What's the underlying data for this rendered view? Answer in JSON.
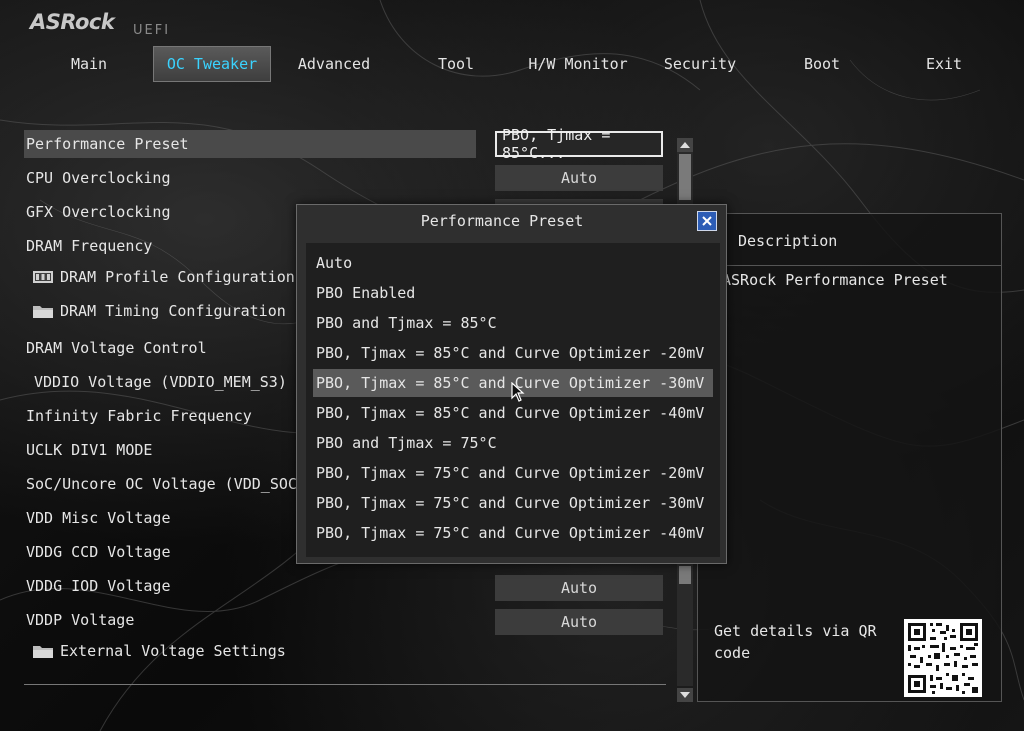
{
  "brand": {
    "logo": "ASRock",
    "sub": "UEFI"
  },
  "tabs": [
    {
      "label": "Main"
    },
    {
      "label": "OC Tweaker",
      "active": true
    },
    {
      "label": "Advanced"
    },
    {
      "label": "Tool"
    },
    {
      "label": "H/W Monitor"
    },
    {
      "label": "Security"
    },
    {
      "label": "Boot"
    },
    {
      "label": "Exit"
    }
  ],
  "settings": [
    {
      "label": "Performance Preset",
      "value": "PBO, Tjmax = 85°C..."
    },
    {
      "label": "CPU Overclocking",
      "value": "Auto"
    },
    {
      "label": "GFX Overclocking"
    },
    {
      "label": "DRAM Frequency"
    },
    {
      "label": "DRAM Profile Configuration",
      "icon": "memory-module-icon"
    },
    {
      "label": "DRAM Timing Configuration",
      "icon": "folder-icon"
    },
    {
      "label": "DRAM Voltage Control"
    },
    {
      "label": "VDDIO Voltage (VDDIO_MEM_S3)"
    },
    {
      "label": "Infinity Fabric Frequency"
    },
    {
      "label": "UCLK DIV1 MODE"
    },
    {
      "label": "SoC/Uncore OC Voltage (VDD_SOC)"
    },
    {
      "label": "VDD Misc Voltage"
    },
    {
      "label": "VDDG CCD Voltage"
    },
    {
      "label": "VDDG IOD Voltage",
      "value": "Auto"
    },
    {
      "label": "VDDP Voltage",
      "value": "Auto"
    },
    {
      "label": "External Voltage Settings",
      "icon": "folder-icon"
    }
  ],
  "description": {
    "title": "Description",
    "text": "ASRock Performance Preset",
    "qr_label": "Get details via QR code"
  },
  "popup": {
    "title": "Performance Preset",
    "options": [
      "Auto",
      "PBO Enabled",
      "PBO and Tjmax = 85°C",
      "PBO, Tjmax = 85°C and Curve Optimizer -20mV",
      "PBO, Tjmax = 85°C and Curve Optimizer -30mV",
      "PBO, Tjmax = 85°C and Curve Optimizer -40mV",
      "PBO and Tjmax = 75°C",
      "PBO, Tjmax = 75°C and Curve Optimizer -20mV",
      "PBO, Tjmax = 75°C and Curve Optimizer -30mV",
      "PBO, Tjmax = 75°C and Curve Optimizer -40mV"
    ],
    "hovered_option": "PBO, Tjmax = 85°C and Curve Optimizer -30mV"
  },
  "colors": {
    "accent": "#3ad3ff",
    "close_button": "#2d5db6"
  }
}
